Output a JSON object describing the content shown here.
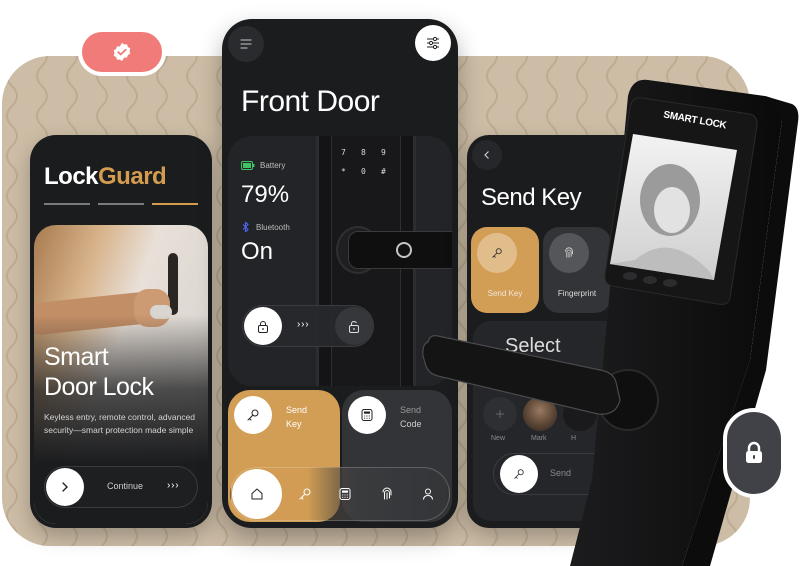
{
  "colors": {
    "accent_gold": "#d29d54",
    "badge_coral": "#f17b78",
    "panel_dark": "#1b1c1e",
    "backdrop_beige": "#cdbda6",
    "battery_green": "#3ec463",
    "bluetooth_blue": "#4a66f0"
  },
  "badge": {
    "icon": "verified-check-icon"
  },
  "onboarding": {
    "brand_part1": "Lock",
    "brand_part2": "Guard",
    "progress": {
      "total_steps": 3,
      "active_step": 3
    },
    "hero_title_line1": "Smart",
    "hero_title_line2": "Door Lock",
    "hero_description": "Keyless entry, remote control, advanced security—smart protection made simple",
    "continue_label": "Continue",
    "continue_chevrons": "› › ›"
  },
  "home": {
    "title": "Front Door",
    "menu_icon": "menu-icon",
    "filter_icon": "sliders-icon",
    "battery_label": "Battery",
    "battery_value": "79%",
    "bluetooth_label": "Bluetooth",
    "bluetooth_value": "On",
    "keypad_keys": [
      "7",
      "8",
      "9",
      "*",
      "0",
      "#"
    ],
    "slider_chevrons": "› › ›",
    "actions": [
      {
        "line1": "Send",
        "line2": "Key",
        "icon": "key-icon"
      },
      {
        "line1": "Send",
        "line2": "Code",
        "icon": "keypad-icon"
      }
    ],
    "nav": [
      {
        "name": "home",
        "icon": "home-icon",
        "active": true
      },
      {
        "name": "keys",
        "icon": "key-icon",
        "active": false
      },
      {
        "name": "codes",
        "icon": "keypad-icon",
        "active": false
      },
      {
        "name": "fingerprint",
        "icon": "fingerprint-icon",
        "active": false
      },
      {
        "name": "profile",
        "icon": "user-icon",
        "active": false
      }
    ]
  },
  "send_key": {
    "title": "Send Key",
    "options": [
      {
        "label": "Send Key",
        "icon": "key-icon",
        "selected": true
      },
      {
        "label": "Fingerprint",
        "icon": "fingerprint-icon",
        "selected": false
      }
    ],
    "select_heading": "Select",
    "contacts": [
      {
        "label": "New"
      },
      {
        "label": "Mark"
      },
      {
        "label": "H"
      }
    ],
    "send_label": "Send"
  },
  "device": {
    "brand_label": "SMART LOCK"
  },
  "lock_fab": {
    "icon": "lock-icon"
  }
}
